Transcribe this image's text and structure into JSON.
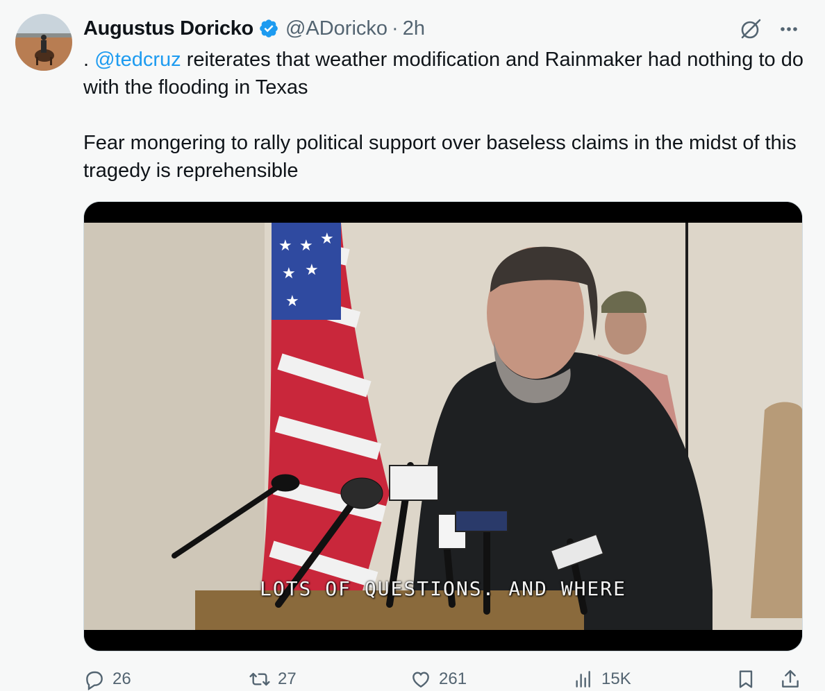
{
  "author": {
    "display_name": "Augustus Doricko",
    "handle": "@ADoricko",
    "separator": "·",
    "time": "2h"
  },
  "tweet": {
    "prefix": ". ",
    "mention": "@tedcruz",
    "line1_rest": " reiterates that weather modification and Rainmaker had nothing to do with the flooding in Texas",
    "paragraph2": "Fear mongering to rally political support over baseless claims in the midst of this tragedy is reprehensible"
  },
  "media": {
    "caption": "LOTS OF QUESTIONS. AND WHERE"
  },
  "actions": {
    "replies": "26",
    "reposts": "27",
    "likes": "261",
    "views": "15K"
  },
  "colors": {
    "accent": "#1d9bf0",
    "muted": "#536471",
    "background": "#f7f8f8"
  },
  "icons": {
    "verified": "verified-badge-icon",
    "grok": "grok-icon",
    "more": "more-icon",
    "reply": "reply-icon",
    "repost": "repost-icon",
    "like": "like-icon",
    "views": "views-icon",
    "bookmark": "bookmark-icon",
    "share": "share-icon"
  }
}
